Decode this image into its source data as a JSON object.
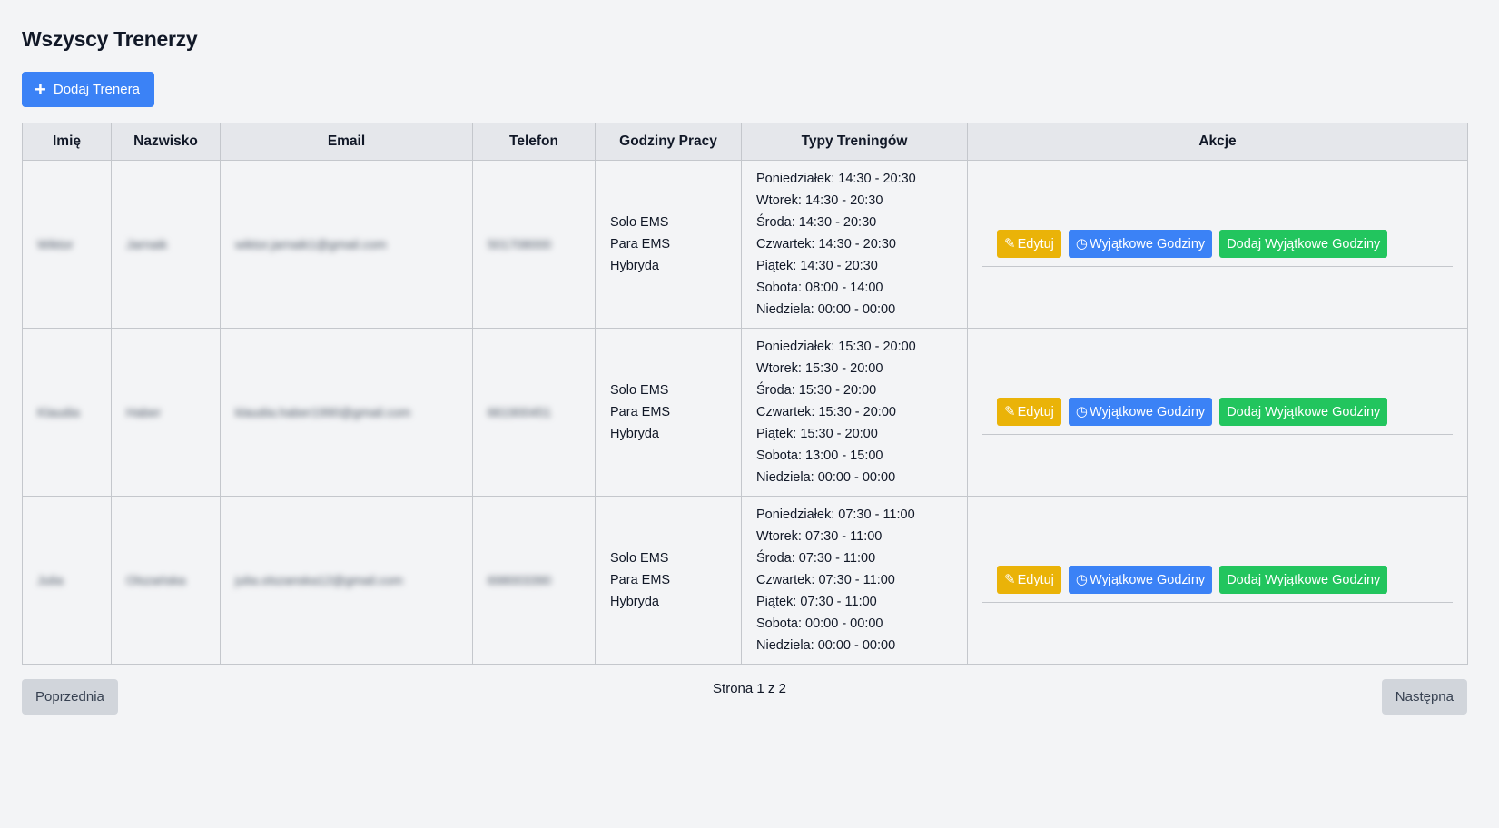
{
  "page": {
    "title": "Wszyscy Trenerzy",
    "add_button_label": "Dodaj Trenera",
    "add_button_icon": "plus-icon"
  },
  "table": {
    "headers": [
      "Imię",
      "Nazwisko",
      "Email",
      "Telefon",
      "Godziny Pracy",
      "Typy Treningów",
      "Akcje"
    ],
    "rows": [
      {
        "first_name": "Wiktor",
        "last_name": "Jarnaik",
        "email": "wiktor.jarnaik1@gmail.com",
        "phone": "501708000",
        "training_types": [
          "Solo EMS",
          "Para EMS",
          "Hybryda"
        ],
        "hours": [
          "Poniedziałek: 14:30 - 20:30",
          "Wtorek: 14:30 - 20:30",
          "Środa: 14:30 - 20:30",
          "Czwartek: 14:30 - 20:30",
          "Piątek: 14:30 - 20:30",
          "Sobota: 08:00 - 14:00",
          "Niedziela: 00:00 - 00:00"
        ]
      },
      {
        "first_name": "Klaudia",
        "last_name": "Haber",
        "email": "klaudia.haber1990@gmail.com",
        "phone": "661900451",
        "training_types": [
          "Solo EMS",
          "Para EMS",
          "Hybryda"
        ],
        "hours": [
          "Poniedziałek: 15:30 - 20:00",
          "Wtorek: 15:30 - 20:00",
          "Środa: 15:30 - 20:00",
          "Czwartek: 15:30 - 20:00",
          "Piątek: 15:30 - 20:00",
          "Sobota: 13:00 - 15:00",
          "Niedziela: 00:00 - 00:00"
        ]
      },
      {
        "first_name": "Julia",
        "last_name": "Olszańska",
        "email": "julia.olszanska12@gmail.com",
        "phone": "698003390",
        "training_types": [
          "Solo EMS",
          "Para EMS",
          "Hybryda"
        ],
        "hours": [
          "Poniedziałek: 07:30 - 11:00",
          "Wtorek: 07:30 - 11:00",
          "Środa: 07:30 - 11:00",
          "Czwartek: 07:30 - 11:00",
          "Piątek: 07:30 - 11:00",
          "Sobota: 00:00 - 00:00",
          "Niedziela: 00:00 - 00:00"
        ]
      }
    ]
  },
  "actions": {
    "edit_label": "Edytuj",
    "edit_icon": "edit-icon",
    "exceptions_label": "Wyjątkowe Godziny",
    "exceptions_icon": "clock-icon",
    "add_exceptions_label": "Dodaj Wyjątkowe Godziny"
  },
  "pagination": {
    "prev_label": "Poprzednia",
    "page_text": "Strona 1 z 2",
    "next_label": "Następna"
  },
  "colors": {
    "primary": "#3b82f6",
    "warning": "#eab308",
    "success": "#22c55e",
    "background": "#f3f4f6",
    "header_bg": "#e5e7eb"
  }
}
